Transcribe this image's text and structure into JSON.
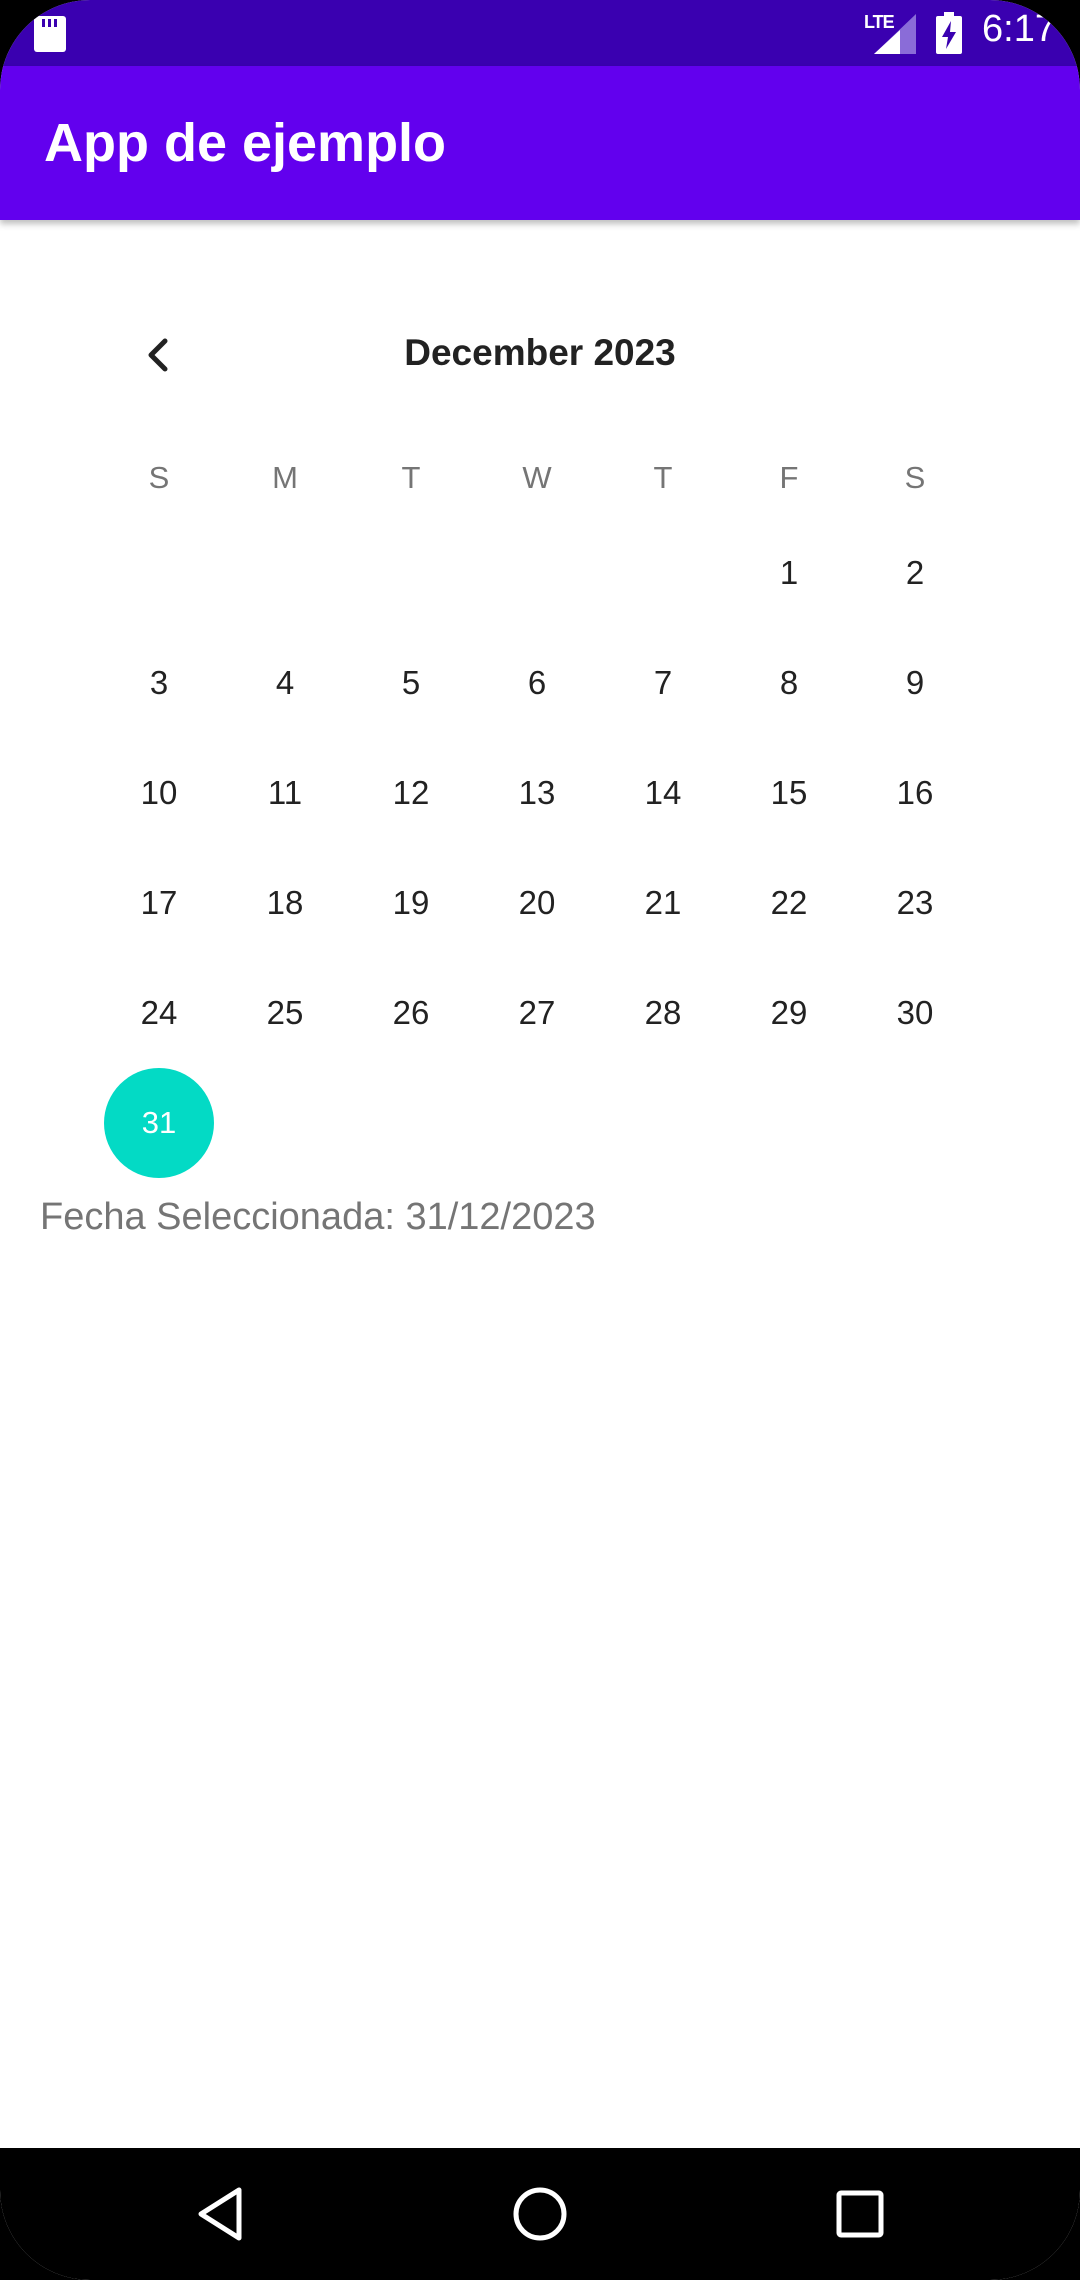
{
  "status_bar": {
    "network_label": "LTE",
    "time": "6:17",
    "icons": [
      "sd-card-icon",
      "signal-icon",
      "battery-charging-icon"
    ]
  },
  "app_bar": {
    "title": "App de ejemplo"
  },
  "calendar": {
    "month_label": "December 2023",
    "prev_icon": "chevron-left-icon",
    "weekdays": [
      "S",
      "M",
      "T",
      "W",
      "T",
      "F",
      "S"
    ],
    "weeks": [
      [
        "",
        "",
        "",
        "",
        "",
        "1",
        "2"
      ],
      [
        "3",
        "4",
        "5",
        "6",
        "7",
        "8",
        "9"
      ],
      [
        "10",
        "11",
        "12",
        "13",
        "14",
        "15",
        "16"
      ],
      [
        "17",
        "18",
        "19",
        "20",
        "21",
        "22",
        "23"
      ],
      [
        "24",
        "25",
        "26",
        "27",
        "28",
        "29",
        "30"
      ],
      [
        "31",
        "",
        "",
        "",
        "",
        "",
        ""
      ]
    ],
    "selected_day": "31",
    "selected_color": "#03dac5"
  },
  "selected_date_text": "Fecha Seleccionada: 31/12/2023",
  "nav_bar": {
    "icons": [
      "back-icon",
      "home-icon",
      "recents-icon"
    ]
  },
  "colors": {
    "status_bar": "#3a00b0",
    "app_bar": "#6200ee",
    "accent": "#03dac5"
  }
}
